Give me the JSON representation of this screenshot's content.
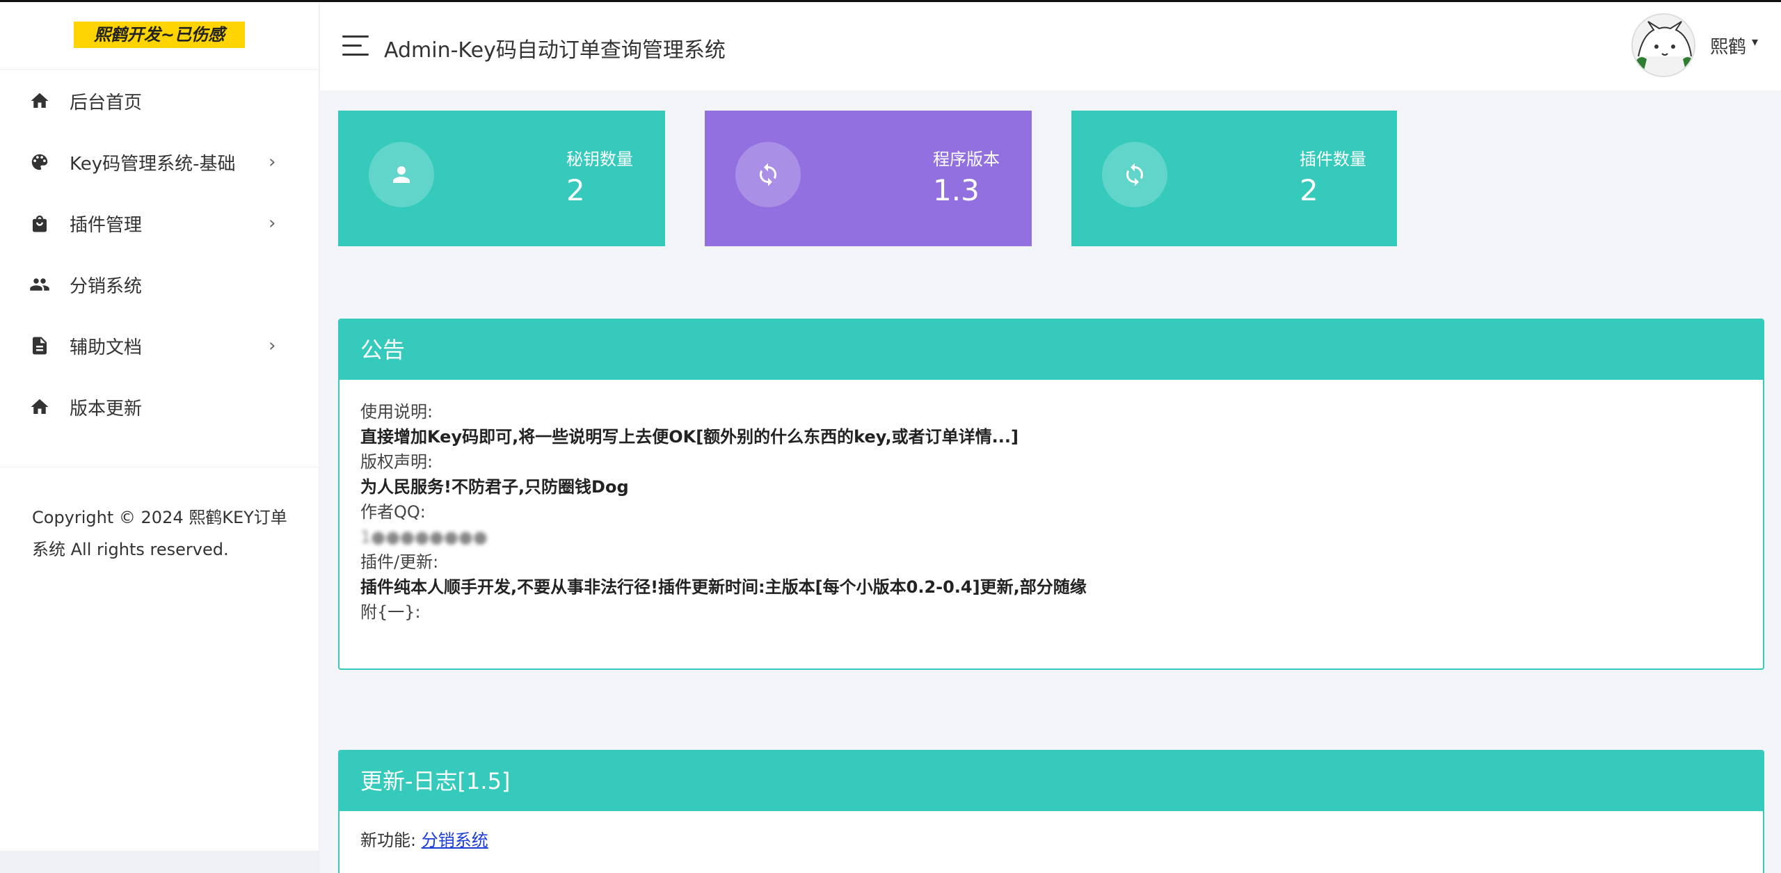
{
  "brand": "熙鹤开发~已伤感",
  "sidebar": {
    "items": [
      {
        "label": "后台首页",
        "icon": "home-icon",
        "has_submenu": false
      },
      {
        "label": "Key码管理系统-基础",
        "icon": "palette-icon",
        "has_submenu": true
      },
      {
        "label": "插件管理",
        "icon": "shopping-bag-icon",
        "has_submenu": true
      },
      {
        "label": "分销系统",
        "icon": "people-icon",
        "has_submenu": false
      },
      {
        "label": "辅助文档",
        "icon": "document-icon",
        "has_submenu": true
      },
      {
        "label": "版本更新",
        "icon": "home-icon",
        "has_submenu": false
      }
    ],
    "chevron": "›",
    "copyright": "Copyright © 2024 熙鹤KEY订单系统 All rights reserved."
  },
  "header": {
    "title": "Admin-Key码自动订单查询管理系统",
    "user_name": "熙鹤",
    "caret": "▾"
  },
  "stats": [
    {
      "label": "秘钥数量",
      "value": "2",
      "icon": "user-icon",
      "color": "#35cabc"
    },
    {
      "label": "程序版本",
      "value": "1.3",
      "icon": "refresh-icon",
      "color": "#9370e0"
    },
    {
      "label": "插件数量",
      "value": "2",
      "icon": "refresh-icon",
      "color": "#35cabc"
    }
  ],
  "notice": {
    "title": "公告",
    "usage_label": "使用说明:",
    "usage_text": "直接增加Key码即可,将一些说明写上去便OK[额外别的什么东西的key,或者订单详情...]",
    "copyright_label": "版权声明:",
    "copyright_text": "为人民服务!不防君子,只防圈钱Dog",
    "qq_label": "作者QQ:",
    "qq_value": "1●●●●●●●●",
    "plugin_label": "插件/更新:",
    "plugin_text": "插件纯本人顺手开发,不要从事非法行径!插件更新时间:主版本[每个小版本0.2-0.4]更新,部分随缘",
    "appendix_label": "附{一}:"
  },
  "changelog": {
    "title": "更新-日志[1.5]",
    "feature_label": "新功能: ",
    "feature_link": "分销系统"
  },
  "colors": {
    "accent": "#35cabc",
    "purple": "#9370e0",
    "brand_bg": "#ffd400"
  }
}
